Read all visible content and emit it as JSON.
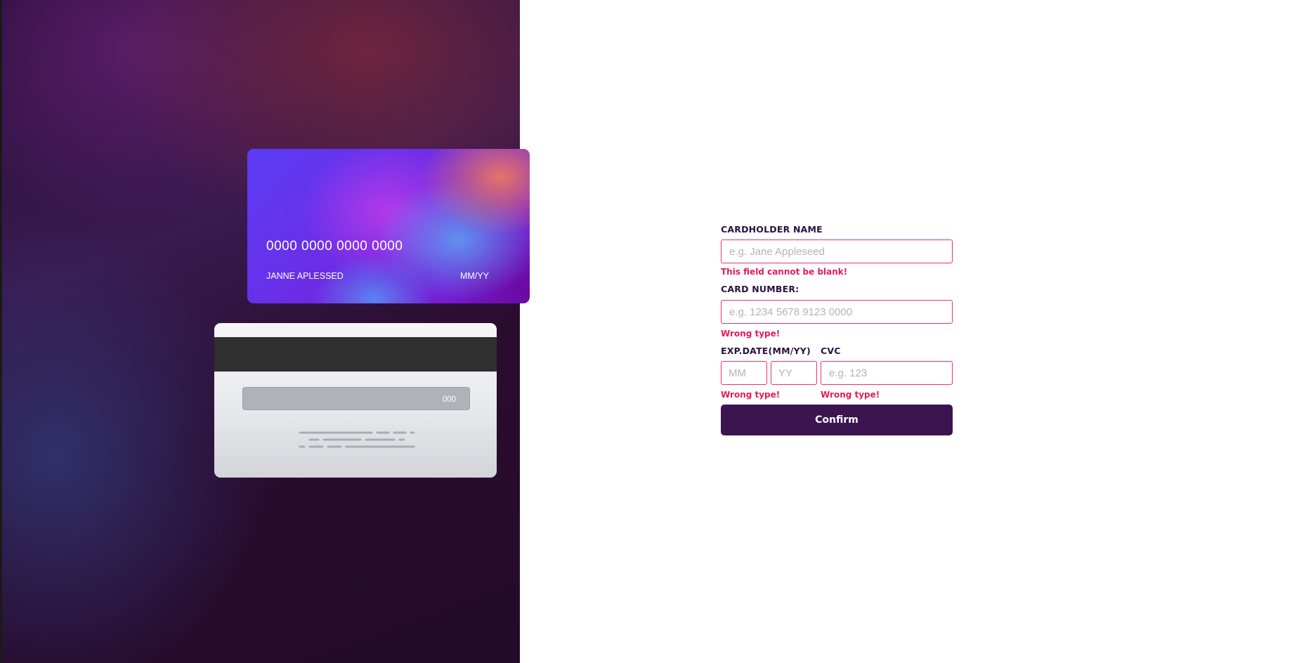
{
  "card_front": {
    "number": "0000 0000 0000 0000",
    "holder": "JANNE APLESSED",
    "expiry": "MM/YY"
  },
  "card_back": {
    "cvc": "000"
  },
  "form": {
    "cardholder": {
      "label": "CARDHOLDER NAME",
      "placeholder": "e.g. Jane Appleseed",
      "value": "",
      "error": "This field cannot be blank!"
    },
    "card_number": {
      "label": "CARD NUMBER:",
      "placeholder": "e.g. 1234 5678 9123 0000",
      "value": "",
      "error": "Wrong type!"
    },
    "exp_date": {
      "label": "EXP.DATE(MM/YY)",
      "month_placeholder": "MM",
      "year_placeholder": "YY",
      "error": "Wrong type!"
    },
    "cvc": {
      "label": "CVC",
      "placeholder": "e.g. 123",
      "error": "Wrong type!"
    },
    "confirm_label": "Confirm"
  },
  "colors": {
    "accent": "#3b1450",
    "error": "#e51b5a",
    "input_border_error": "#e8326d",
    "label": "#2a1140"
  }
}
